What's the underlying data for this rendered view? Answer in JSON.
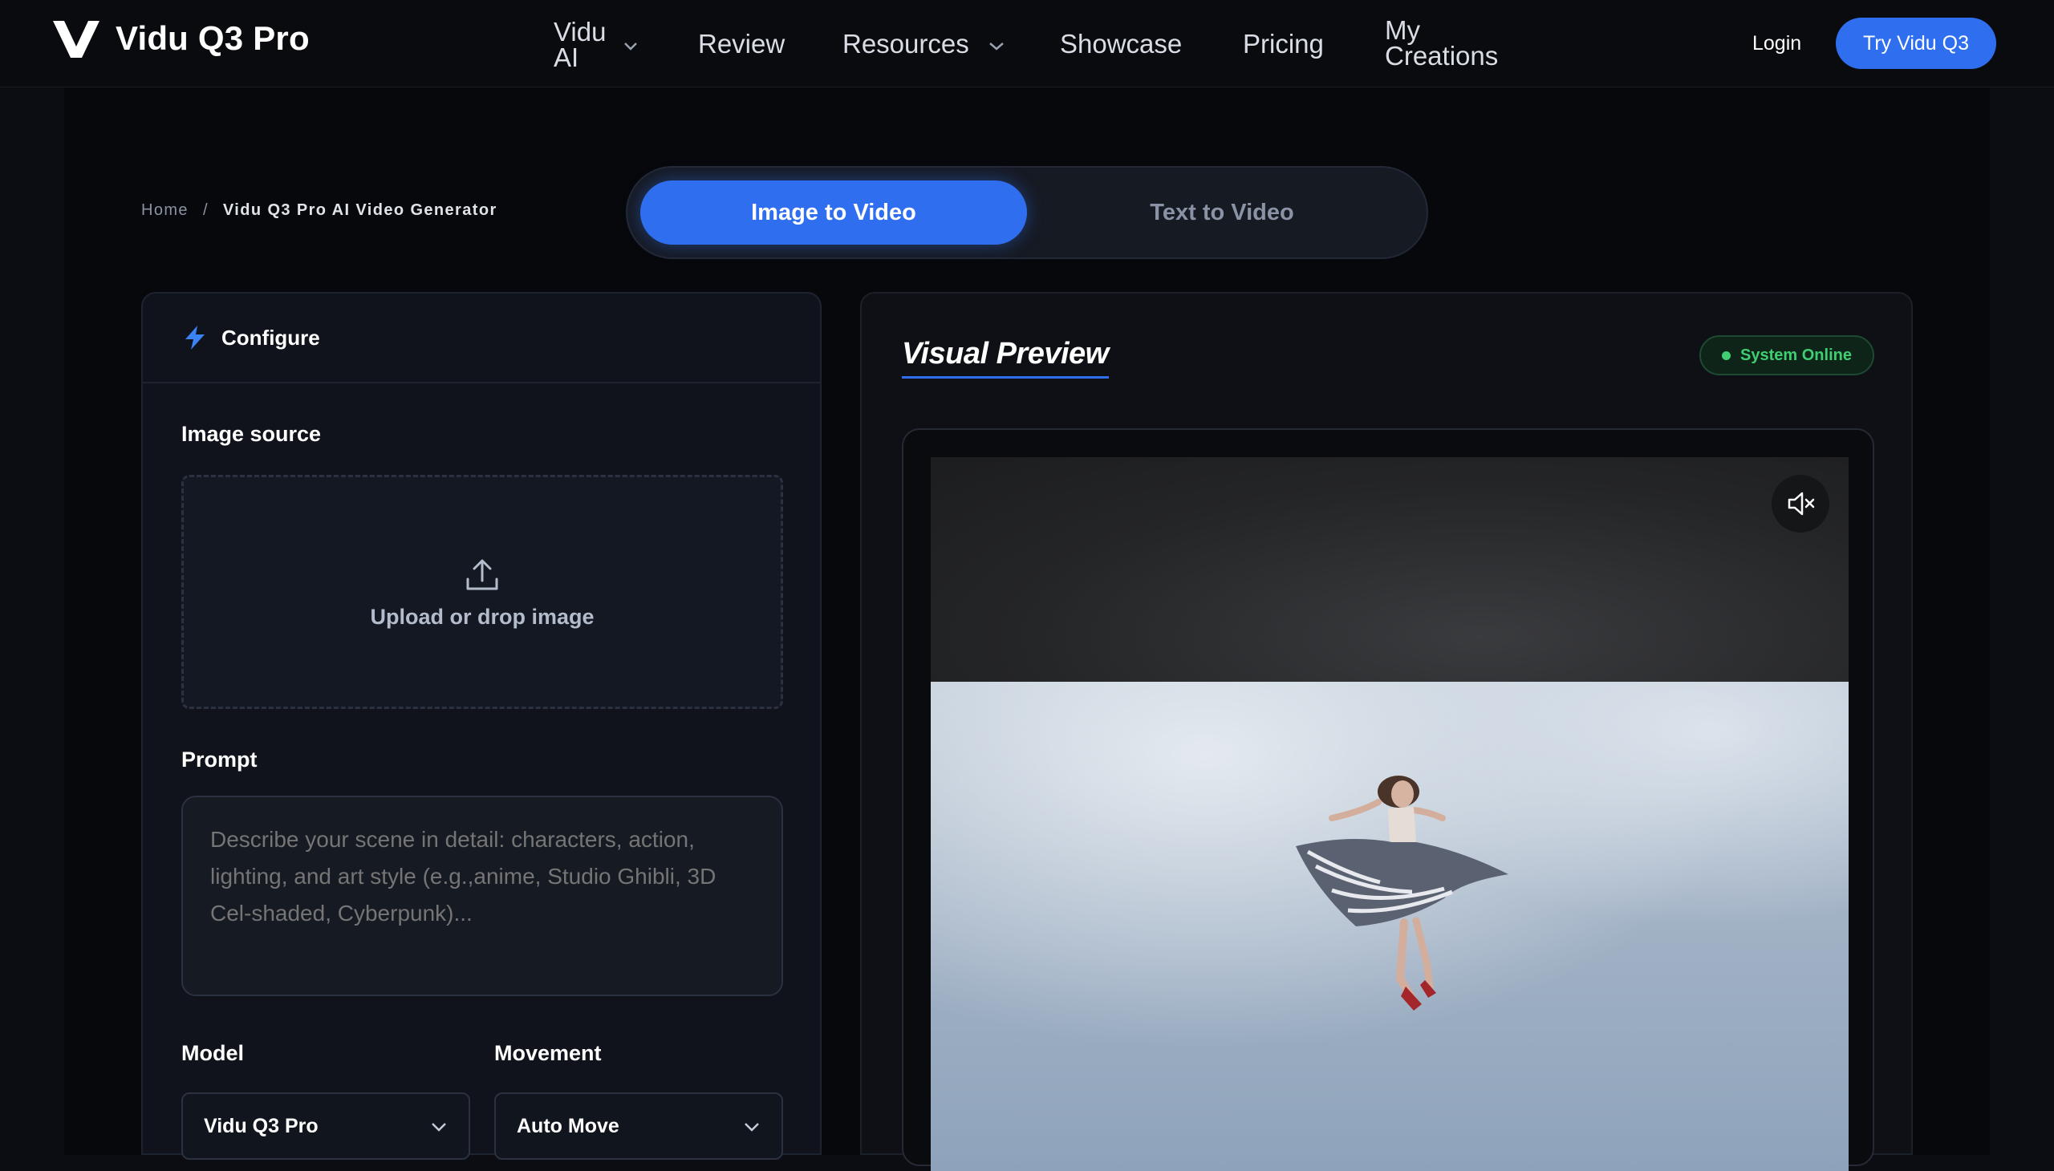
{
  "brand": {
    "name": "Vidu Q3 Pro",
    "logo_icon": "v-logo-icon"
  },
  "nav": {
    "items": [
      {
        "label": "Vidu AI",
        "has_dropdown": true
      },
      {
        "label": "Review"
      },
      {
        "label": "Resources",
        "has_dropdown": true
      },
      {
        "label": "Showcase"
      },
      {
        "label": "Pricing"
      },
      {
        "label": "My Creations"
      }
    ],
    "login": "Login",
    "cta": "Try Vidu Q3"
  },
  "breadcrumb": {
    "home": "Home",
    "separator": "/",
    "current": "Vidu Q3 Pro AI Video Generator"
  },
  "mode_toggle": {
    "options": [
      "Image to Video",
      "Text to Video"
    ],
    "active": "Image to Video"
  },
  "config": {
    "title": "Configure",
    "icon": "lightning-bolt-icon",
    "image_source": {
      "label": "Image source",
      "upload_text": "Upload or drop image",
      "icon": "upload-icon"
    },
    "prompt": {
      "label": "Prompt",
      "placeholder": "Describe your scene in detail: characters, action, lighting, and art style (e.g.,anime, Studio Ghibli, 3D Cel-shaded, Cyberpunk)...",
      "value": ""
    },
    "model": {
      "label": "Model",
      "value": "Vidu Q3 Pro"
    },
    "movement": {
      "label": "Movement",
      "value": "Auto Move"
    }
  },
  "preview": {
    "title": "Visual Preview",
    "status": "System Online",
    "mute_icon": "speaker-muted-icon"
  },
  "colors": {
    "accent": "#2f6fef",
    "status_green": "#3fce72",
    "background": "#0b0d12",
    "panel": "#10131b"
  }
}
